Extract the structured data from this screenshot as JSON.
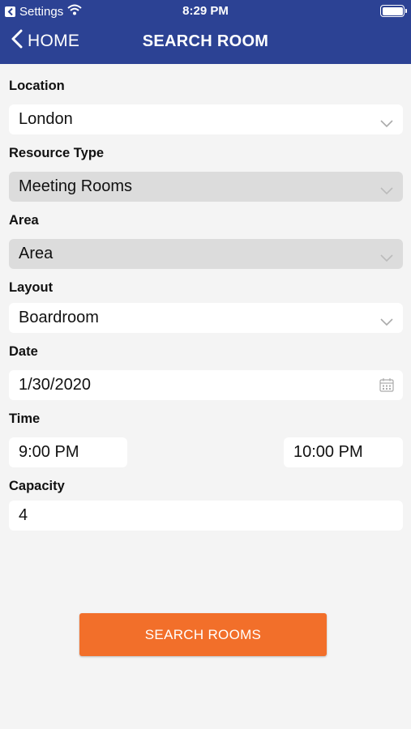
{
  "status_bar": {
    "back_app": "Settings",
    "time": "8:29 PM"
  },
  "nav": {
    "back_label": "HOME",
    "title": "SEARCH ROOM"
  },
  "form": {
    "location": {
      "label": "Location",
      "value": "London"
    },
    "resource_type": {
      "label": "Resource Type",
      "value": "Meeting Rooms"
    },
    "area": {
      "label": "Area",
      "value": "Area"
    },
    "layout": {
      "label": "Layout",
      "value": "Boardroom"
    },
    "date": {
      "label": "Date",
      "value": "1/30/2020"
    },
    "time": {
      "label": "Time",
      "start": "9:00 PM",
      "end": "10:00 PM"
    },
    "capacity": {
      "label": "Capacity",
      "value": "4"
    }
  },
  "search_button": {
    "label": "SEARCH ROOMS"
  },
  "colors": {
    "header": "#2c4294",
    "button": "#f26f2a",
    "disabled_field": "#dcdcdc",
    "background": "#f4f4f4"
  }
}
